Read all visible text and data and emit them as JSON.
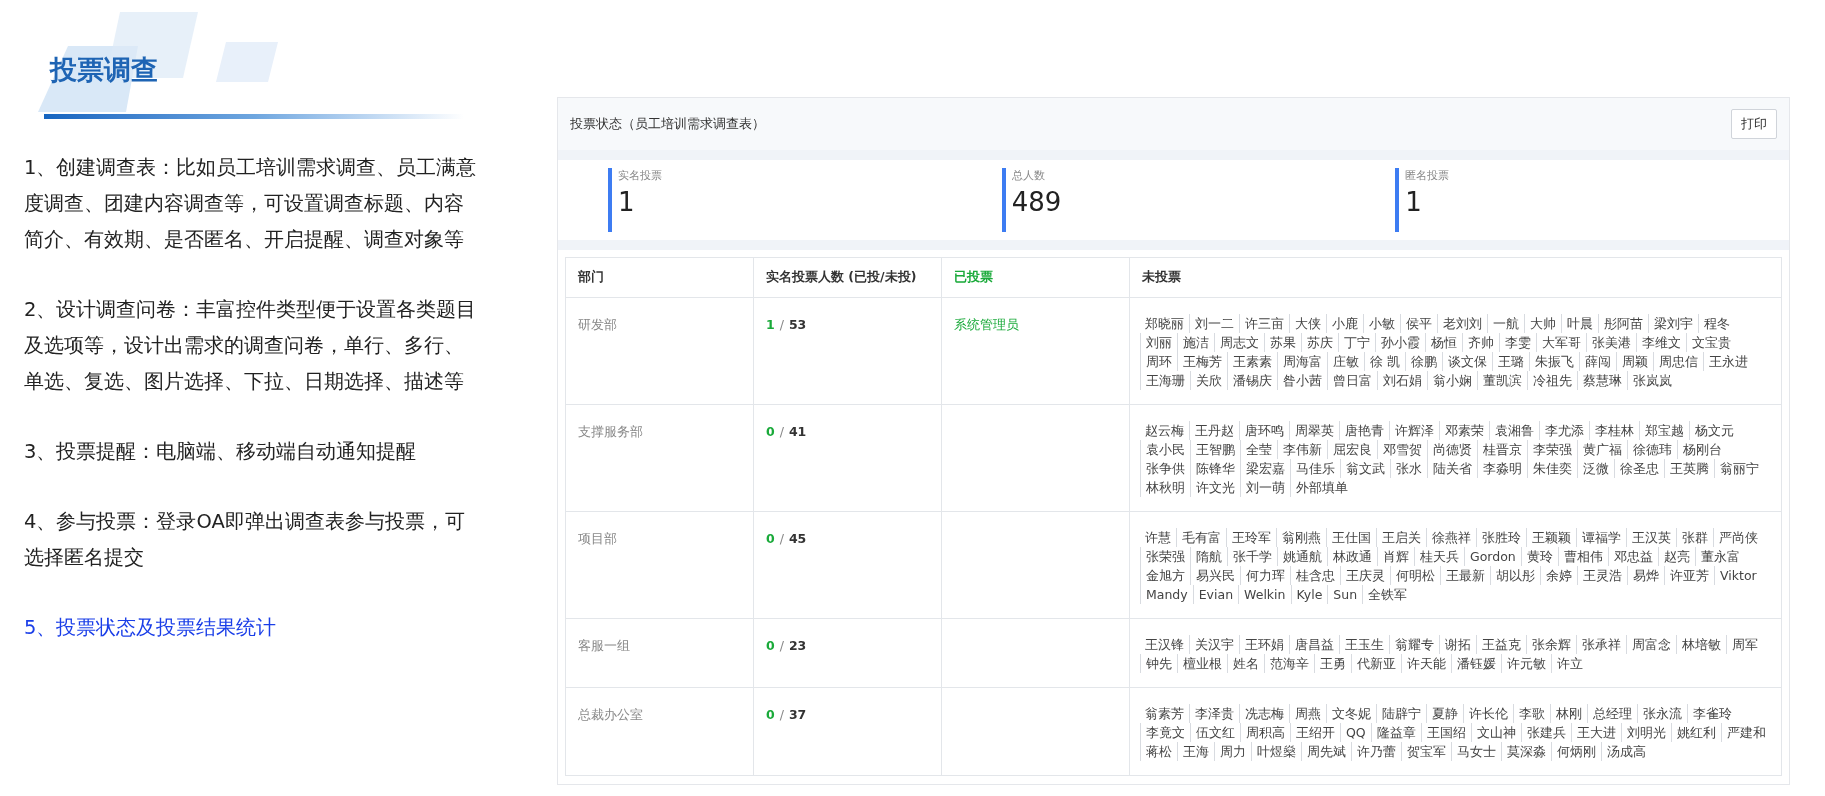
{
  "intro": {
    "title": "投票调查",
    "paragraphs": [
      {
        "text": "1、创建调查表：比如员工培训需求调查、员工满意度调查、团建内容调查等，可设置调查标题、内容简介、有效期、是否匿名、开启提醒、调查对象等",
        "highlighted": false
      },
      {
        "text": "2、设计调查问卷：丰富控件类型便于设置各类题目及选项等，设计出需求的调查问卷，单行、多行、单选、复选、图片选择、下拉、日期选择、描述等",
        "highlighted": false
      },
      {
        "text": "3、投票提醒：电脑端、移动端自动通知提醒",
        "highlighted": false
      },
      {
        "text": "4、参与投票：登录OA即弹出调查表参与投票，可选择匿名提交",
        "highlighted": false
      },
      {
        "text": "5、投票状态及投票结果统计",
        "highlighted": true
      }
    ]
  },
  "panel": {
    "title": "投票状态（员工培训需求调查表）",
    "print_button": "打印",
    "stats": [
      {
        "label": "实名投票",
        "value": "1"
      },
      {
        "label": "总人数",
        "value": "489"
      },
      {
        "label": "匿名投票",
        "value": "1"
      }
    ],
    "table": {
      "columns": [
        "部门",
        "实名投票人数 (已投/未投)",
        "已投票",
        "未投票"
      ],
      "rows": [
        {
          "department": "研发部",
          "voted_count": "1",
          "separator": "/",
          "total": "53",
          "voted": [
            "系统管理员"
          ],
          "not_voted": [
            "郑晓丽",
            "刘一二",
            "许三亩",
            "大侠",
            "小鹿",
            "小敏",
            "侯平",
            "老刘刘",
            "一航",
            "大帅",
            "叶晨",
            "彤阿苗",
            "梁刘宇",
            "程冬",
            "刘丽",
            "施洁",
            "周志文",
            "苏果",
            "苏庆",
            "丁宁",
            "孙小霞",
            "杨恒",
            "齐帅",
            "李雯",
            "大军哥",
            "张美港",
            "李维文",
            "文宝贵",
            "周环",
            "王梅芳",
            "王素素",
            "周海富",
            "庄敏",
            "徐 凯",
            "徐鹏",
            "谈文保",
            "王璐",
            "朱振飞",
            "薛闯",
            "周颖",
            "周忠信",
            "王永进",
            "王海珊",
            "关欣",
            "潘锡庆",
            "昝小茜",
            "曾日富",
            "刘石娟",
            "翁小娴",
            "董凯滨",
            "冷祖先",
            "蔡慧琳",
            "张岚岚"
          ]
        },
        {
          "department": "支撑服务部",
          "voted_count": "0",
          "separator": "/",
          "total": "41",
          "voted": [],
          "not_voted": [
            "赵云梅",
            "王丹赵",
            "唐环鸣",
            "周翠英",
            "唐艳青",
            "许辉泽",
            "邓素荣",
            "袁湘鲁",
            "李尤添",
            "李桂林",
            "郑宝越",
            "杨文元",
            "袁小民",
            "王智鹏",
            "全莹",
            "李伟新",
            "屈宏良",
            "邓雪贺",
            "尚德贤",
            "桂晋京",
            "李荣强",
            "黄广福",
            "徐德玮",
            "杨刚台",
            "张争供",
            "陈锋华",
            "梁宏嘉",
            "马佳乐",
            "翁文武",
            "张水",
            "陆关省",
            "李淼明",
            "朱佳奕",
            "泛微",
            "徐圣忠",
            "王英腾",
            "翁丽宁",
            "林秋明",
            "许文光",
            "刘一萌",
            "外部填单"
          ]
        },
        {
          "department": "项目部",
          "voted_count": "0",
          "separator": "/",
          "total": "45",
          "voted": [],
          "not_voted": [
            "许慧",
            "毛有富",
            "王玲军",
            "翁刚燕",
            "王仕国",
            "王启关",
            "徐燕祥",
            "张胜玲",
            "王颖颖",
            "谭福学",
            "王汉英",
            "张群",
            "严尚侠",
            "张荣强",
            "隋航",
            "张千学",
            "姚通航",
            "林政通",
            "肖辉",
            "桂天兵",
            "Gordon",
            "黄玲",
            "曹相伟",
            "邓忠益",
            "赵亮",
            "董永富",
            "金旭方",
            "易兴民",
            "何力珲",
            "桂含忠",
            "王庆灵",
            "何明松",
            "王最新",
            "胡以彤",
            "余婷",
            "王灵浩",
            "易烨",
            "许亚芳",
            "Viktor",
            "Mandy",
            "Evian",
            "Welkin",
            "Kyle",
            "Sun",
            "全铁军"
          ]
        },
        {
          "department": "客服一组",
          "voted_count": "0",
          "separator": "/",
          "total": "23",
          "voted": [],
          "not_voted": [
            "王汉锋",
            "关汉宇",
            "王环娟",
            "唐昌益",
            "王玉生",
            "翁耀专",
            "谢拓",
            "王益克",
            "张余辉",
            "张承祥",
            "周富念",
            "林培敏",
            "周军",
            "钟先",
            "檀业根",
            "姓名",
            "范海辛",
            "王勇",
            "代新亚",
            "许天能",
            "潘钰媛",
            "许元敏",
            "许立"
          ]
        },
        {
          "department": "总裁办公室",
          "voted_count": "0",
          "separator": "/",
          "total": "37",
          "voted": [],
          "not_voted": [
            "翁素芳",
            "李泽贵",
            "冼志梅",
            "周燕",
            "文冬妮",
            "陆辟宁",
            "夏静",
            "许长伦",
            "李歌",
            "林刚",
            "总经理",
            "张永流",
            "李雀玲",
            "李竟文",
            "伍文红",
            "周积高",
            "王绍开",
            "QQ",
            "隆益章",
            "王国绍",
            "文山神",
            "张建兵",
            "王大进",
            "刘明光",
            "姚红利",
            "严建和",
            "蒋松",
            "王海",
            "周力",
            "叶煜燊",
            "周先斌",
            "许乃蕾",
            "贺宝军",
            "马女士",
            "莫深淼",
            "何炳刚",
            "汤成高"
          ]
        }
      ]
    }
  }
}
